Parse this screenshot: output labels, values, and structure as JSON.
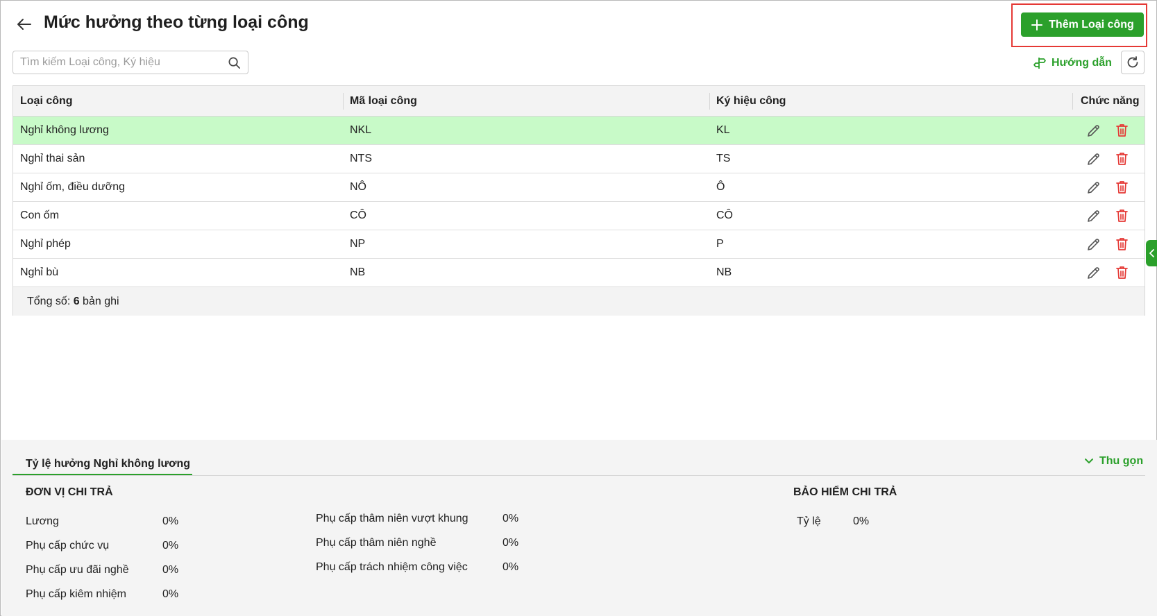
{
  "header": {
    "title": "Mức hưởng theo từng loại công",
    "add_button_label": "Thêm Loại công"
  },
  "toolbar": {
    "search_placeholder": "Tìm kiếm Loại công, Ký hiệu",
    "guide_label": "Hướng dẫn"
  },
  "table": {
    "columns": [
      "Loại công",
      "Mã loại công",
      "Ký hiệu công",
      "Chức năng"
    ],
    "rows": [
      {
        "type": "Nghỉ không lương",
        "code": "NKL",
        "symbol": "KL",
        "selected": true
      },
      {
        "type": "Nghỉ thai sản",
        "code": "NTS",
        "symbol": "TS"
      },
      {
        "type": "Nghỉ ốm, điều dưỡng",
        "code": "NÔ",
        "symbol": "Ô"
      },
      {
        "type": "Con ốm",
        "code": "CÔ",
        "symbol": "CÔ"
      },
      {
        "type": "Nghỉ phép",
        "code": "NP",
        "symbol": "P"
      },
      {
        "type": "Nghỉ bù",
        "code": "NB",
        "symbol": "NB"
      }
    ],
    "footer": {
      "prefix": "Tổng số: ",
      "count": "6",
      "suffix": " bản ghi"
    }
  },
  "panel": {
    "tab_label": "Tỷ lệ hưởng Nghỉ không lương",
    "collapse_label": "Thu gọn",
    "employer": {
      "title": "ĐƠN VỊ CHI TRẢ",
      "col1": [
        {
          "label": "Lương",
          "value": "0%"
        },
        {
          "label": "Phụ cấp chức vụ",
          "value": "0%"
        },
        {
          "label": "Phụ cấp ưu đãi nghề",
          "value": "0%"
        },
        {
          "label": "Phụ cấp kiêm nhiệm",
          "value": "0%"
        }
      ],
      "col2": [
        {
          "label": "Phụ cấp thâm niên vượt khung",
          "value": "0%"
        },
        {
          "label": "Phụ cấp thâm niên nghề",
          "value": "0%"
        },
        {
          "label": "Phụ cấp trách nhiệm công việc",
          "value": "0%"
        }
      ]
    },
    "insurance": {
      "title": "BẢO HIỂM CHI TRẢ",
      "items": [
        {
          "label": "Tỷ lệ",
          "value": "0%"
        }
      ]
    }
  },
  "colors": {
    "accent": "#2ba02b",
    "selected_row": "#c8fac8",
    "delete": "#e53935",
    "highlight_box": "#e53935"
  },
  "icons": [
    "back-arrow-icon",
    "plus-icon",
    "search-icon",
    "guide-signpost-icon",
    "refresh-icon",
    "edit-pencil-icon",
    "trash-icon",
    "chevron-left-icon",
    "chevron-down-icon"
  ]
}
